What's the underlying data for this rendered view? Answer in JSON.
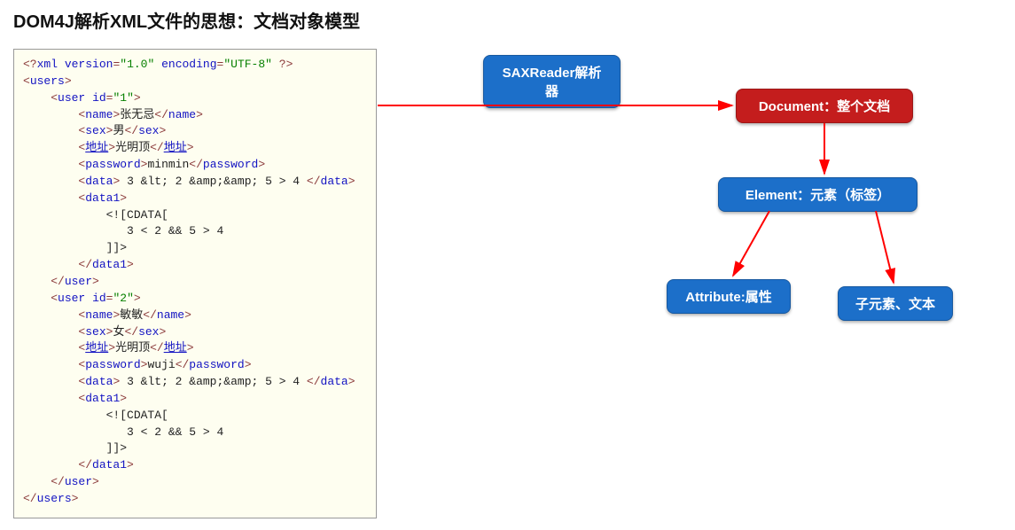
{
  "title": "DOM4J解析XML文件的思想：文档对象模型",
  "nodes": {
    "saxreader": "SAXReader解析器",
    "document": "Document：整个文档",
    "element": "Element：元素（标签）",
    "attribute": "Attribute:属性",
    "child": "子元素、文本"
  },
  "xml_sample": {
    "pi_version": "1.0",
    "pi_encoding": "UTF-8",
    "root": "users",
    "users": [
      {
        "id": "1",
        "name": "张无忌",
        "sex": "男",
        "address": "光明顶",
        "password": "minmin",
        "data_encoded": " 3 &lt; 2 &amp;&amp; 5 > 4 ",
        "data1_cdata": "3 < 2 && 5 > 4"
      },
      {
        "id": "2",
        "name": "敏敏",
        "sex": "女",
        "address": "光明顶",
        "password": "wuji",
        "data_encoded": " 3 &lt; 2 &amp;&amp; 5 > 4 ",
        "data1_cdata": "3 < 2 && 5 > 4"
      }
    ]
  }
}
